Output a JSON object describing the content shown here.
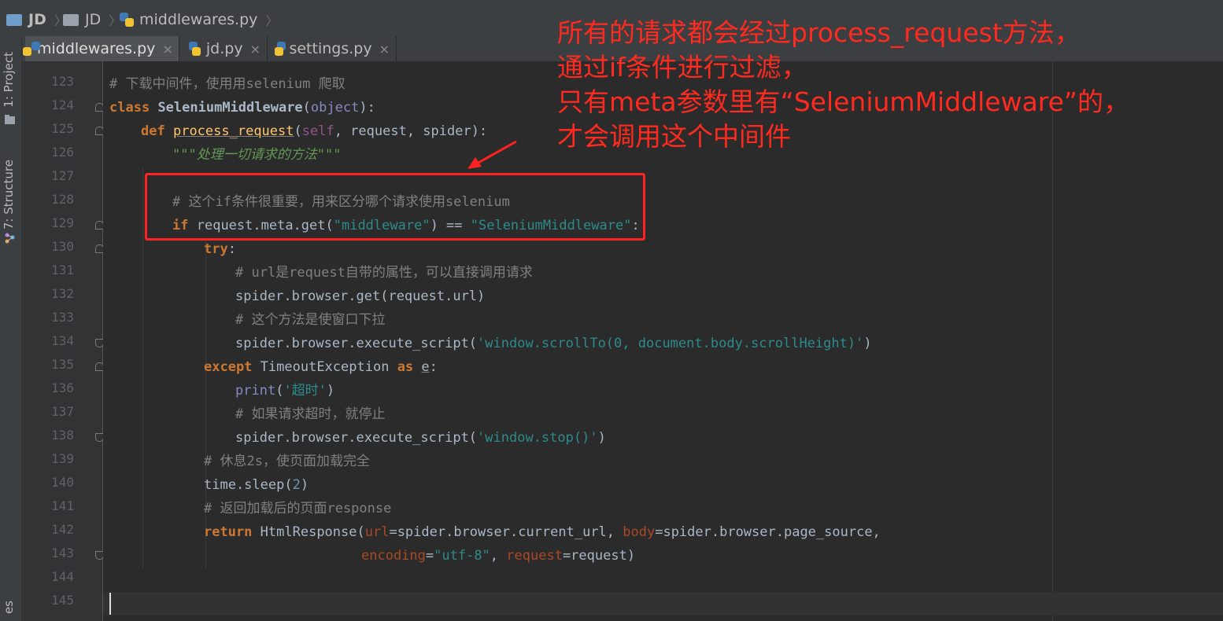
{
  "breadcrumbs": [
    "JD",
    "JD",
    "middlewares.py"
  ],
  "tabs": [
    {
      "label": "middlewares.py",
      "active": true
    },
    {
      "label": "jd.py",
      "active": false
    },
    {
      "label": "settings.py",
      "active": false
    }
  ],
  "close_glyph": "×",
  "tool_windows": [
    "1: Project",
    "7: Structure",
    "es"
  ],
  "line_numbers": [
    "123",
    "124",
    "125",
    "126",
    "127",
    "128",
    "129",
    "130",
    "131",
    "132",
    "133",
    "134",
    "135",
    "136",
    "137",
    "138",
    "139",
    "140",
    "141",
    "142",
    "143",
    "144",
    "145"
  ],
  "code": {
    "l123": "# 下载中间件，使用用selenium 爬取",
    "l124_kw": "class",
    "l124_name": "SeleniumMiddleware",
    "l124_open": "(",
    "l124_base": "object",
    "l124_close": "):",
    "l125_kw": "def",
    "l125_name": "process_request",
    "l125_open": "(",
    "l125_self": "self",
    "l125_rest": ", request, spider):",
    "l126": "\"\"\"处理一切请求的方法\"\"\"",
    "l128": "# 这个if条件很重要，用来区分哪个请求使用selenium",
    "l129_kw": "if",
    "l129_mid": "request.meta.get(",
    "l129_s1": "\"middleware\"",
    "l129_op": ") == ",
    "l129_s2": "\"SeleniumMiddleware\"",
    "l129_end": ":",
    "l130_kw": "try",
    "l130_end": ":",
    "l131": "# url是request自带的属性，可以直接调用请求",
    "l132": "spider.browser.get(request.url)",
    "l133": "# 这个方法是使窗口下拉",
    "l134_a": "spider.browser.execute_script(",
    "l134_s": "'window.scrollTo(0, document.body.scrollHeight)'",
    "l134_b": ")",
    "l135_kw": "except",
    "l135_mid": "TimeoutException",
    "l135_as": "as",
    "l135_e": "e",
    "l135_end": ":",
    "l136_fn": "print",
    "l136_open": "(",
    "l136_s": "'超时'",
    "l136_close": ")",
    "l137": "# 如果请求超时，就停止",
    "l138_a": "spider.browser.execute_script(",
    "l138_s": "'window.stop()'",
    "l138_b": ")",
    "l139": "# 休息2s，使页面加载完全",
    "l140_a": "time.sleep(",
    "l140_n": "2",
    "l140_b": ")",
    "l141": "# 返回加载后的页面response",
    "l142_kw": "return",
    "l142_a": "HtmlResponse(",
    "l142_p1": "url",
    "l142_b": "=spider.browser.current_url, ",
    "l142_p2": "body",
    "l142_c": "=spider.browser.page_source,",
    "l143_p1": "encoding",
    "l143_eq": "=",
    "l143_s": "\"utf-8\"",
    "l143_comma": ", ",
    "l143_p2": "request",
    "l143_end": "=request)"
  },
  "annotation": {
    "line1": "所有的请求都会经过process_request方法，",
    "line2": "通过if条件进行过滤，",
    "line3": "只有meta参数里有“SeleniumMiddleware”的，",
    "line4": "才会调用这个中间件"
  },
  "colors": {
    "background": "#2b2b2b",
    "keyword": "#cc7832",
    "comment": "#808080",
    "string": "#6a8759",
    "annotation_red": "#ff2a1f"
  }
}
